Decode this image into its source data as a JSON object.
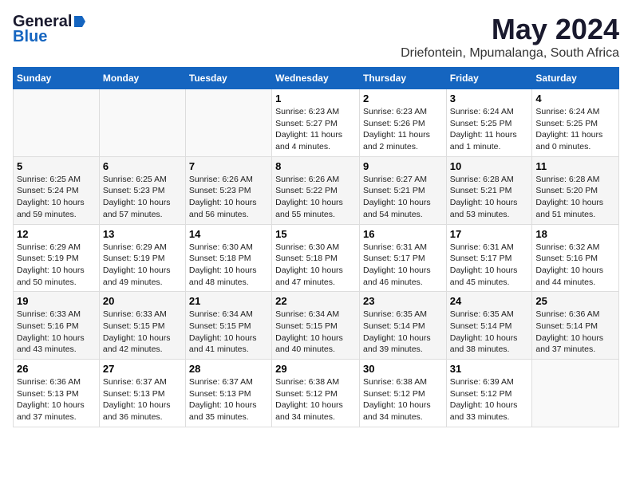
{
  "header": {
    "logo_general": "General",
    "logo_blue": "Blue",
    "month_year": "May 2024",
    "location": "Driefontein, Mpumalanga, South Africa"
  },
  "days_of_week": [
    "Sunday",
    "Monday",
    "Tuesday",
    "Wednesday",
    "Thursday",
    "Friday",
    "Saturday"
  ],
  "weeks": [
    [
      {
        "day": "",
        "info": ""
      },
      {
        "day": "",
        "info": ""
      },
      {
        "day": "",
        "info": ""
      },
      {
        "day": "1",
        "info": "Sunrise: 6:23 AM\nSunset: 5:27 PM\nDaylight: 11 hours\nand 4 minutes."
      },
      {
        "day": "2",
        "info": "Sunrise: 6:23 AM\nSunset: 5:26 PM\nDaylight: 11 hours\nand 2 minutes."
      },
      {
        "day": "3",
        "info": "Sunrise: 6:24 AM\nSunset: 5:25 PM\nDaylight: 11 hours\nand 1 minute."
      },
      {
        "day": "4",
        "info": "Sunrise: 6:24 AM\nSunset: 5:25 PM\nDaylight: 11 hours\nand 0 minutes."
      }
    ],
    [
      {
        "day": "5",
        "info": "Sunrise: 6:25 AM\nSunset: 5:24 PM\nDaylight: 10 hours\nand 59 minutes."
      },
      {
        "day": "6",
        "info": "Sunrise: 6:25 AM\nSunset: 5:23 PM\nDaylight: 10 hours\nand 57 minutes."
      },
      {
        "day": "7",
        "info": "Sunrise: 6:26 AM\nSunset: 5:23 PM\nDaylight: 10 hours\nand 56 minutes."
      },
      {
        "day": "8",
        "info": "Sunrise: 6:26 AM\nSunset: 5:22 PM\nDaylight: 10 hours\nand 55 minutes."
      },
      {
        "day": "9",
        "info": "Sunrise: 6:27 AM\nSunset: 5:21 PM\nDaylight: 10 hours\nand 54 minutes."
      },
      {
        "day": "10",
        "info": "Sunrise: 6:28 AM\nSunset: 5:21 PM\nDaylight: 10 hours\nand 53 minutes."
      },
      {
        "day": "11",
        "info": "Sunrise: 6:28 AM\nSunset: 5:20 PM\nDaylight: 10 hours\nand 51 minutes."
      }
    ],
    [
      {
        "day": "12",
        "info": "Sunrise: 6:29 AM\nSunset: 5:19 PM\nDaylight: 10 hours\nand 50 minutes."
      },
      {
        "day": "13",
        "info": "Sunrise: 6:29 AM\nSunset: 5:19 PM\nDaylight: 10 hours\nand 49 minutes."
      },
      {
        "day": "14",
        "info": "Sunrise: 6:30 AM\nSunset: 5:18 PM\nDaylight: 10 hours\nand 48 minutes."
      },
      {
        "day": "15",
        "info": "Sunrise: 6:30 AM\nSunset: 5:18 PM\nDaylight: 10 hours\nand 47 minutes."
      },
      {
        "day": "16",
        "info": "Sunrise: 6:31 AM\nSunset: 5:17 PM\nDaylight: 10 hours\nand 46 minutes."
      },
      {
        "day": "17",
        "info": "Sunrise: 6:31 AM\nSunset: 5:17 PM\nDaylight: 10 hours\nand 45 minutes."
      },
      {
        "day": "18",
        "info": "Sunrise: 6:32 AM\nSunset: 5:16 PM\nDaylight: 10 hours\nand 44 minutes."
      }
    ],
    [
      {
        "day": "19",
        "info": "Sunrise: 6:33 AM\nSunset: 5:16 PM\nDaylight: 10 hours\nand 43 minutes."
      },
      {
        "day": "20",
        "info": "Sunrise: 6:33 AM\nSunset: 5:15 PM\nDaylight: 10 hours\nand 42 minutes."
      },
      {
        "day": "21",
        "info": "Sunrise: 6:34 AM\nSunset: 5:15 PM\nDaylight: 10 hours\nand 41 minutes."
      },
      {
        "day": "22",
        "info": "Sunrise: 6:34 AM\nSunset: 5:15 PM\nDaylight: 10 hours\nand 40 minutes."
      },
      {
        "day": "23",
        "info": "Sunrise: 6:35 AM\nSunset: 5:14 PM\nDaylight: 10 hours\nand 39 minutes."
      },
      {
        "day": "24",
        "info": "Sunrise: 6:35 AM\nSunset: 5:14 PM\nDaylight: 10 hours\nand 38 minutes."
      },
      {
        "day": "25",
        "info": "Sunrise: 6:36 AM\nSunset: 5:14 PM\nDaylight: 10 hours\nand 37 minutes."
      }
    ],
    [
      {
        "day": "26",
        "info": "Sunrise: 6:36 AM\nSunset: 5:13 PM\nDaylight: 10 hours\nand 37 minutes."
      },
      {
        "day": "27",
        "info": "Sunrise: 6:37 AM\nSunset: 5:13 PM\nDaylight: 10 hours\nand 36 minutes."
      },
      {
        "day": "28",
        "info": "Sunrise: 6:37 AM\nSunset: 5:13 PM\nDaylight: 10 hours\nand 35 minutes."
      },
      {
        "day": "29",
        "info": "Sunrise: 6:38 AM\nSunset: 5:12 PM\nDaylight: 10 hours\nand 34 minutes."
      },
      {
        "day": "30",
        "info": "Sunrise: 6:38 AM\nSunset: 5:12 PM\nDaylight: 10 hours\nand 34 minutes."
      },
      {
        "day": "31",
        "info": "Sunrise: 6:39 AM\nSunset: 5:12 PM\nDaylight: 10 hours\nand 33 minutes."
      },
      {
        "day": "",
        "info": ""
      }
    ]
  ]
}
